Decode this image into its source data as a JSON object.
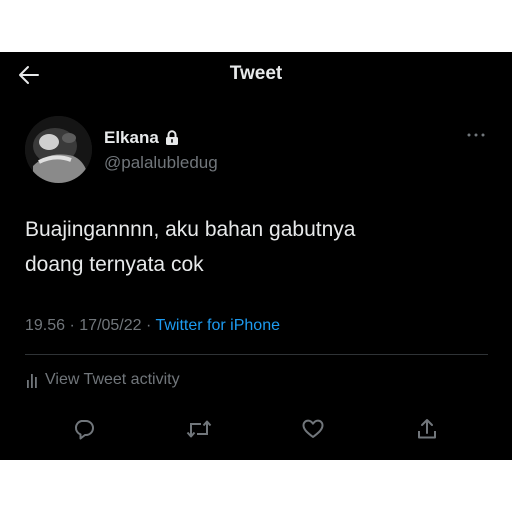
{
  "header": {
    "title": "Tweet",
    "back_icon": "arrow-left-icon"
  },
  "author": {
    "display_name": "Elkana",
    "lock_icon": "lock-icon",
    "handle": "@palalubledug"
  },
  "tweet": {
    "text_line1": "Buajingannnn, aku bahan gabutnya",
    "text_line2": "doang ternyata cok",
    "time": "19.56",
    "separator1": " · ",
    "date": "17/05/22",
    "separator2": " · ",
    "source": "Twitter for iPhone"
  },
  "activity": {
    "label": "View Tweet activity",
    "icon": "bar-chart-icon"
  },
  "actions": [
    {
      "icon": "reply-icon"
    },
    {
      "icon": "retweet-icon"
    },
    {
      "icon": "like-icon"
    },
    {
      "icon": "share-icon"
    }
  ],
  "colors": {
    "background": "#000000",
    "text": "#e7e9ea",
    "secondary": "#71767b",
    "accent": "#1d9bf0"
  }
}
